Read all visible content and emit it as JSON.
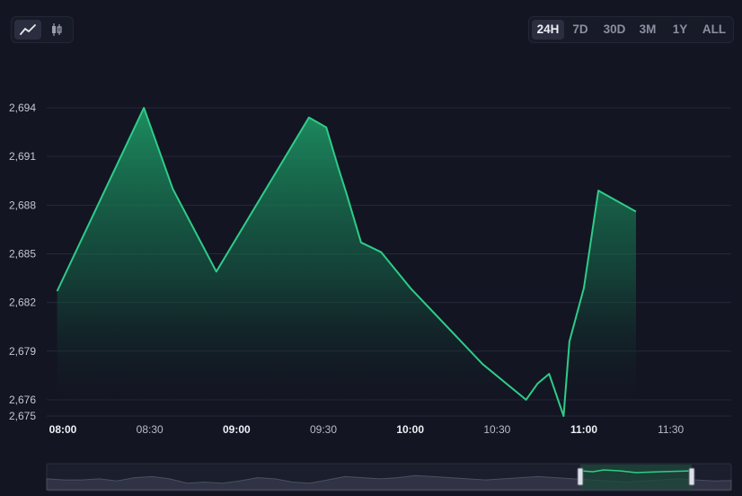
{
  "chart_type_buttons": [
    {
      "icon": "line-chart-icon",
      "active": true
    },
    {
      "icon": "candlestick-icon",
      "active": false
    }
  ],
  "time_ranges": [
    {
      "label": "24H",
      "active": true
    },
    {
      "label": "7D",
      "active": false
    },
    {
      "label": "30D",
      "active": false
    },
    {
      "label": "3M",
      "active": false
    },
    {
      "label": "1Y",
      "active": false
    },
    {
      "label": "ALL",
      "active": false
    }
  ],
  "colors": {
    "background": "#131522",
    "line": "#2ecc88",
    "grid": "#24283a"
  },
  "chart_data": {
    "type": "area",
    "title": "",
    "xlabel": "",
    "ylabel": "",
    "x_ticks": [
      {
        "label": "08:00",
        "t": 0,
        "major": true
      },
      {
        "label": "08:30",
        "t": 30,
        "major": false
      },
      {
        "label": "09:00",
        "t": 60,
        "major": true
      },
      {
        "label": "09:30",
        "t": 90,
        "major": false
      },
      {
        "label": "10:00",
        "t": 120,
        "major": true
      },
      {
        "label": "10:30",
        "t": 150,
        "major": false
      },
      {
        "label": "11:00",
        "t": 180,
        "major": true
      },
      {
        "label": "11:30",
        "t": 210,
        "major": false
      }
    ],
    "y_ticks": [
      "2,675",
      "2,676",
      "2,679",
      "2,682",
      "2,685",
      "2,688",
      "2,691",
      "2,694"
    ],
    "ylim": [
      2675,
      2694
    ],
    "grid": true,
    "series": [
      {
        "x": [
          "07:58",
          "08:28",
          "08:38",
          "08:53",
          "09:25",
          "09:28",
          "09:31",
          "09:35",
          "09:38",
          "09:43",
          "09:50",
          "10:00",
          "10:25",
          "10:40",
          "10:44",
          "10:48",
          "10:53",
          "10:55",
          "11:00",
          "11:05",
          "11:18"
        ],
        "values": [
          2682.7,
          2694.0,
          2689.0,
          2683.9,
          2693.4,
          2693.1,
          2692.8,
          2690.4,
          2688.7,
          2685.7,
          2685.1,
          2682.9,
          2678.2,
          2676.0,
          2677.0,
          2677.6,
          2675.0,
          2679.6,
          2682.9,
          2688.9,
          2687.6
        ]
      }
    ]
  }
}
